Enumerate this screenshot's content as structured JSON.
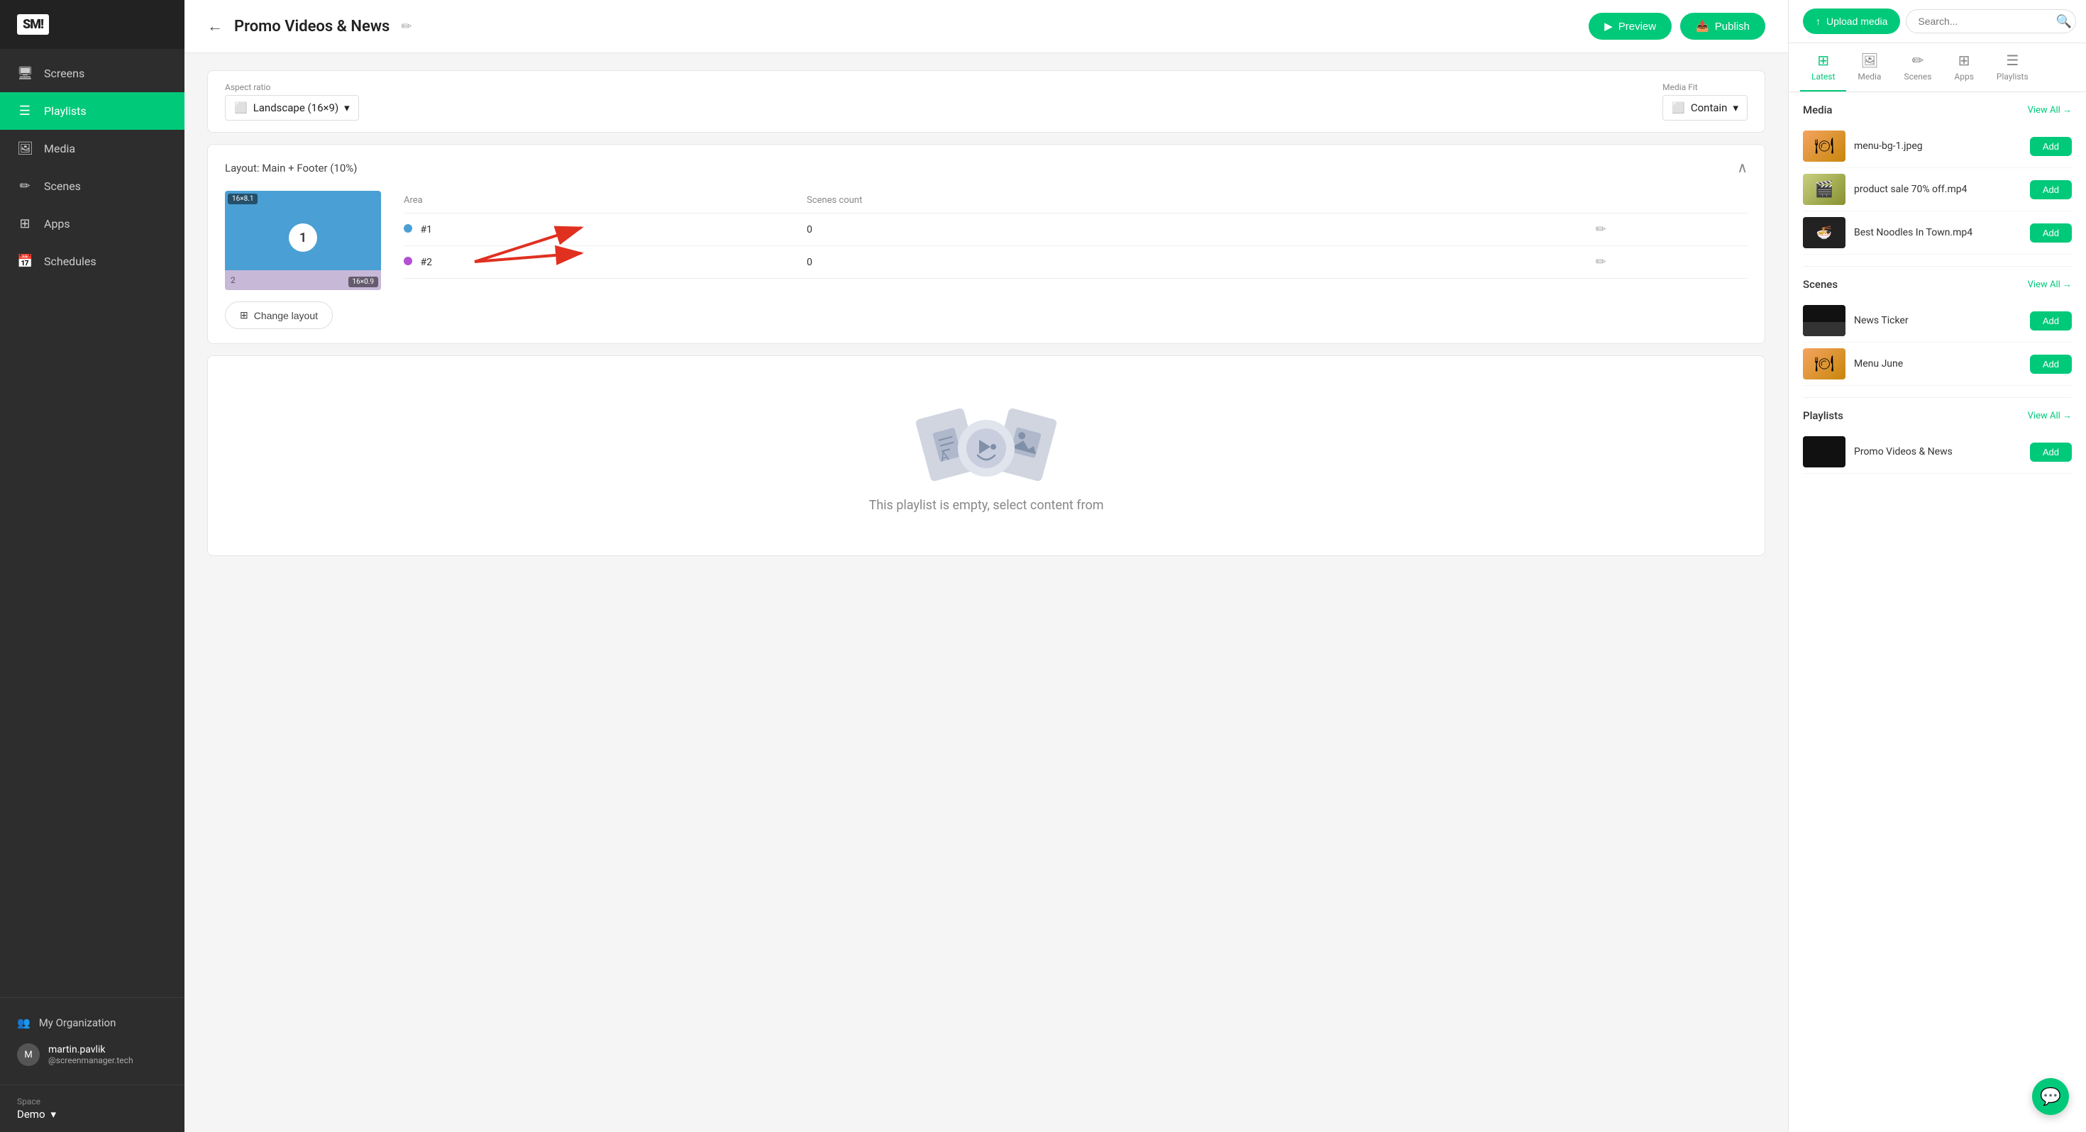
{
  "sidebar": {
    "logo": "SM!",
    "nav_items": [
      {
        "id": "screens",
        "label": "Screens",
        "icon": "🖥"
      },
      {
        "id": "playlists",
        "label": "Playlists",
        "icon": "≡",
        "active": true
      },
      {
        "id": "media",
        "label": "Media",
        "icon": "🖼"
      },
      {
        "id": "scenes",
        "label": "Scenes",
        "icon": "✏"
      },
      {
        "id": "apps",
        "label": "Apps",
        "icon": "⊞"
      },
      {
        "id": "schedules",
        "label": "Schedules",
        "icon": "📅"
      }
    ],
    "org_label": "My Organization",
    "user": {
      "name": "martin.pavlik",
      "email": "@screenmanager.tech"
    },
    "space_label": "Space",
    "space_name": "Demo"
  },
  "topbar": {
    "back_label": "←",
    "title": "Promo Videos & News",
    "edit_icon": "✏",
    "preview_label": "Preview",
    "publish_label": "Publish"
  },
  "settings": {
    "aspect_ratio_label": "Aspect ratio",
    "aspect_ratio_value": "Landscape (16×9)",
    "media_fit_label": "Media Fit",
    "media_fit_value": "Contain"
  },
  "layout": {
    "title": "Layout: Main + Footer (10%)",
    "area_label": "Area",
    "scenes_count_label": "Scenes count",
    "areas": [
      {
        "id": "#1",
        "dot_color": "#4a9fd4",
        "count": 0
      },
      {
        "id": "#2",
        "dot_color": "#b44fd4",
        "count": 0
      }
    ],
    "preview_label_main": "16×8.1",
    "preview_label_footer": "16×0.9",
    "preview_circle": "1",
    "preview_footer_num": "2",
    "change_layout_label": "Change layout"
  },
  "empty": {
    "text": "This playlist is empty, select content from"
  },
  "right_panel": {
    "upload_label": "Upload media",
    "search_placeholder": "Search...",
    "tabs": [
      {
        "id": "latest",
        "label": "Latest",
        "icon": "⊞",
        "active": true
      },
      {
        "id": "media",
        "label": "Media",
        "icon": "🖼"
      },
      {
        "id": "scenes",
        "label": "Scenes",
        "icon": "✏"
      },
      {
        "id": "apps",
        "label": "Apps",
        "icon": "⊞"
      },
      {
        "id": "playlists",
        "label": "Playlists",
        "icon": "≡"
      }
    ],
    "sections": {
      "media": {
        "title": "Media",
        "view_all": "View All →",
        "items": [
          {
            "name": "menu-bg-1.jpeg",
            "type": "image"
          },
          {
            "name": "product sale 70% off.mp4",
            "type": "video"
          },
          {
            "name": "Best Noodles In Town.mp4",
            "type": "dark_video"
          }
        ]
      },
      "scenes": {
        "title": "Scenes",
        "view_all": "View All →",
        "items": [
          {
            "name": "News Ticker",
            "type": "news"
          },
          {
            "name": "Menu June",
            "type": "menu"
          }
        ]
      },
      "playlists": {
        "title": "Playlists",
        "view_all": "View All →",
        "items": [
          {
            "name": "Promo Videos & News",
            "type": "black"
          }
        ]
      }
    },
    "add_label": "Add"
  }
}
